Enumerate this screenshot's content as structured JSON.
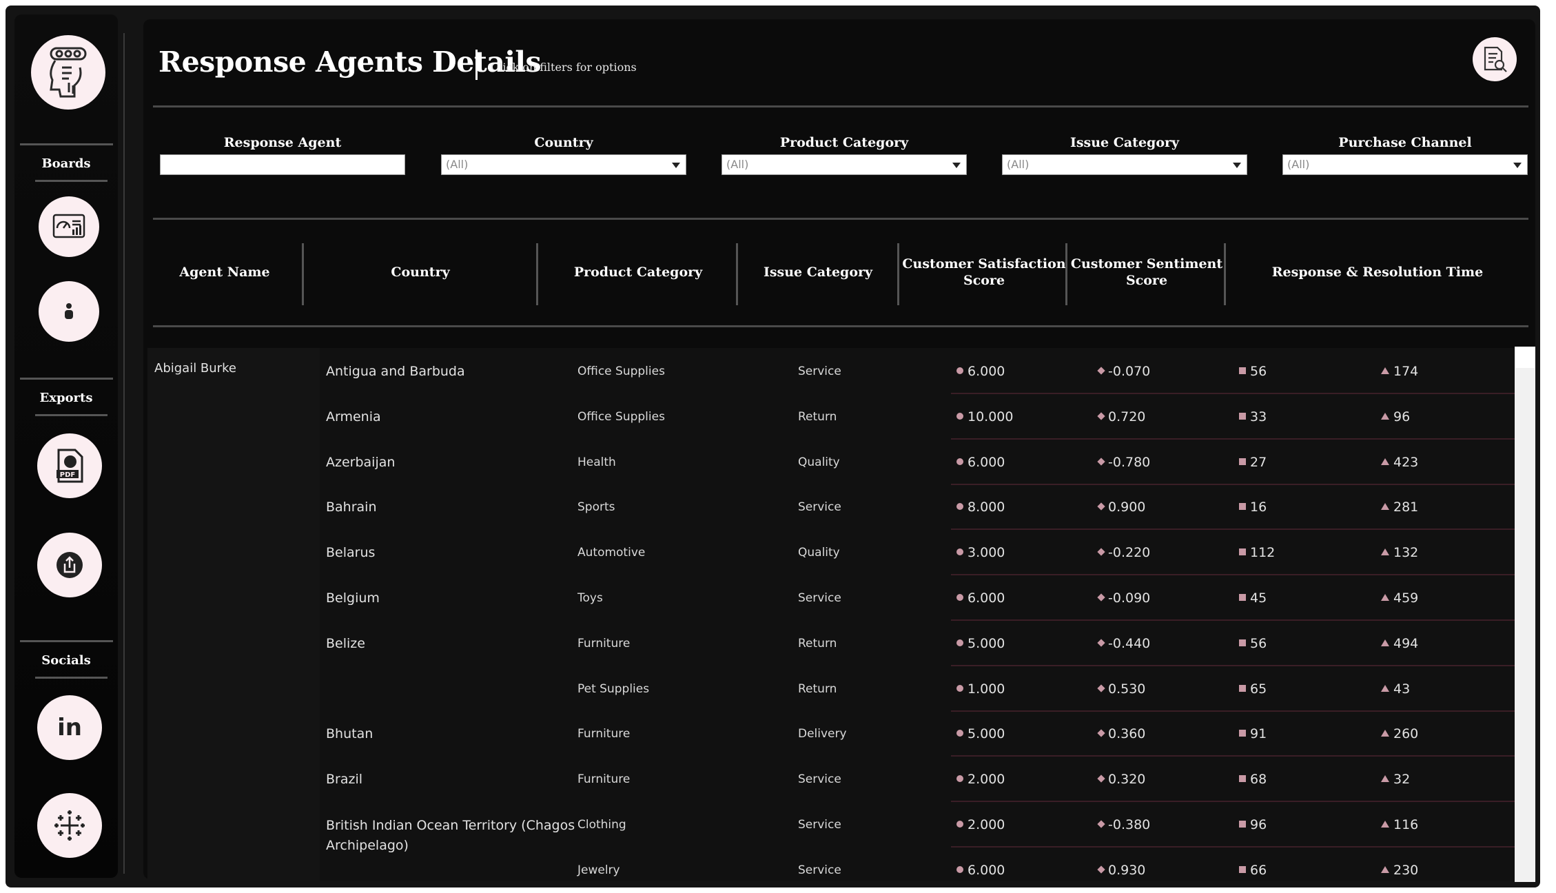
{
  "sidebar": {
    "boards_label": "Boards",
    "exports_label": "Exports",
    "socials_label": "Socials",
    "icons": [
      "agent-logo-icon",
      "dashboard-icon",
      "person-icon",
      "pdf-icon",
      "share-icon",
      "linkedin-icon",
      "tableau-icon"
    ],
    "linkedin_text": "in",
    "pdf_text": "PDF"
  },
  "header": {
    "title": "Response Agents Details",
    "subtitle": "Click on filters for options"
  },
  "filters": [
    {
      "label": "Response Agent",
      "value": ""
    },
    {
      "label": "Country",
      "value": "(All)"
    },
    {
      "label": "Product Category",
      "value": "(All)"
    },
    {
      "label": "Issue Category",
      "value": "(All)"
    },
    {
      "label": "Purchase Channel",
      "value": "(All)"
    }
  ],
  "table": {
    "columns": [
      "Agent Name",
      "Country",
      "Product Category",
      "Issue Category",
      "Customer Satisfaction Score",
      "Customer Sentiment Score",
      "Response & Resolution Time"
    ],
    "agent": "Abigail Burke",
    "rows": [
      {
        "country": "Antigua and Barbuda",
        "product": "Office Supplies",
        "issue": "Service",
        "csat": "6.000",
        "sentiment": "-0.070",
        "response": "56",
        "resolution": "174"
      },
      {
        "country": "Armenia",
        "product": "Office Supplies",
        "issue": "Return",
        "csat": "10.000",
        "sentiment": "0.720",
        "response": "33",
        "resolution": "96"
      },
      {
        "country": "Azerbaijan",
        "product": "Health",
        "issue": "Quality",
        "csat": "6.000",
        "sentiment": "-0.780",
        "response": "27",
        "resolution": "423"
      },
      {
        "country": "Bahrain",
        "product": "Sports",
        "issue": "Service",
        "csat": "8.000",
        "sentiment": "0.900",
        "response": "16",
        "resolution": "281"
      },
      {
        "country": "Belarus",
        "product": "Automotive",
        "issue": "Quality",
        "csat": "3.000",
        "sentiment": "-0.220",
        "response": "112",
        "resolution": "132"
      },
      {
        "country": "Belgium",
        "product": "Toys",
        "issue": "Service",
        "csat": "6.000",
        "sentiment": "-0.090",
        "response": "45",
        "resolution": "459"
      },
      {
        "country": "Belize",
        "product": "Furniture",
        "issue": "Return",
        "csat": "5.000",
        "sentiment": "-0.440",
        "response": "56",
        "resolution": "494"
      },
      {
        "country": "",
        "product": "Pet Supplies",
        "issue": "Return",
        "csat": "1.000",
        "sentiment": "0.530",
        "response": "65",
        "resolution": "43"
      },
      {
        "country": "Bhutan",
        "product": "Furniture",
        "issue": "Delivery",
        "csat": "5.000",
        "sentiment": "0.360",
        "response": "91",
        "resolution": "260"
      },
      {
        "country": "Brazil",
        "product": "Furniture",
        "issue": "Service",
        "csat": "2.000",
        "sentiment": "0.320",
        "response": "68",
        "resolution": "32"
      },
      {
        "country": "British Indian Ocean Territory (Chagos",
        "country2": "Archipelago)",
        "product": "Clothing",
        "issue": "Service",
        "csat": "2.000",
        "sentiment": "-0.380",
        "response": "96",
        "resolution": "116"
      },
      {
        "country": "",
        "product": "Jewelry",
        "issue": "Service",
        "csat": "6.000",
        "sentiment": "0.930",
        "response": "66",
        "resolution": "230"
      }
    ]
  },
  "colors": {
    "background": "#0b0b0b",
    "icon_circle": "#fbeef1",
    "marker": "#c99aa6"
  }
}
